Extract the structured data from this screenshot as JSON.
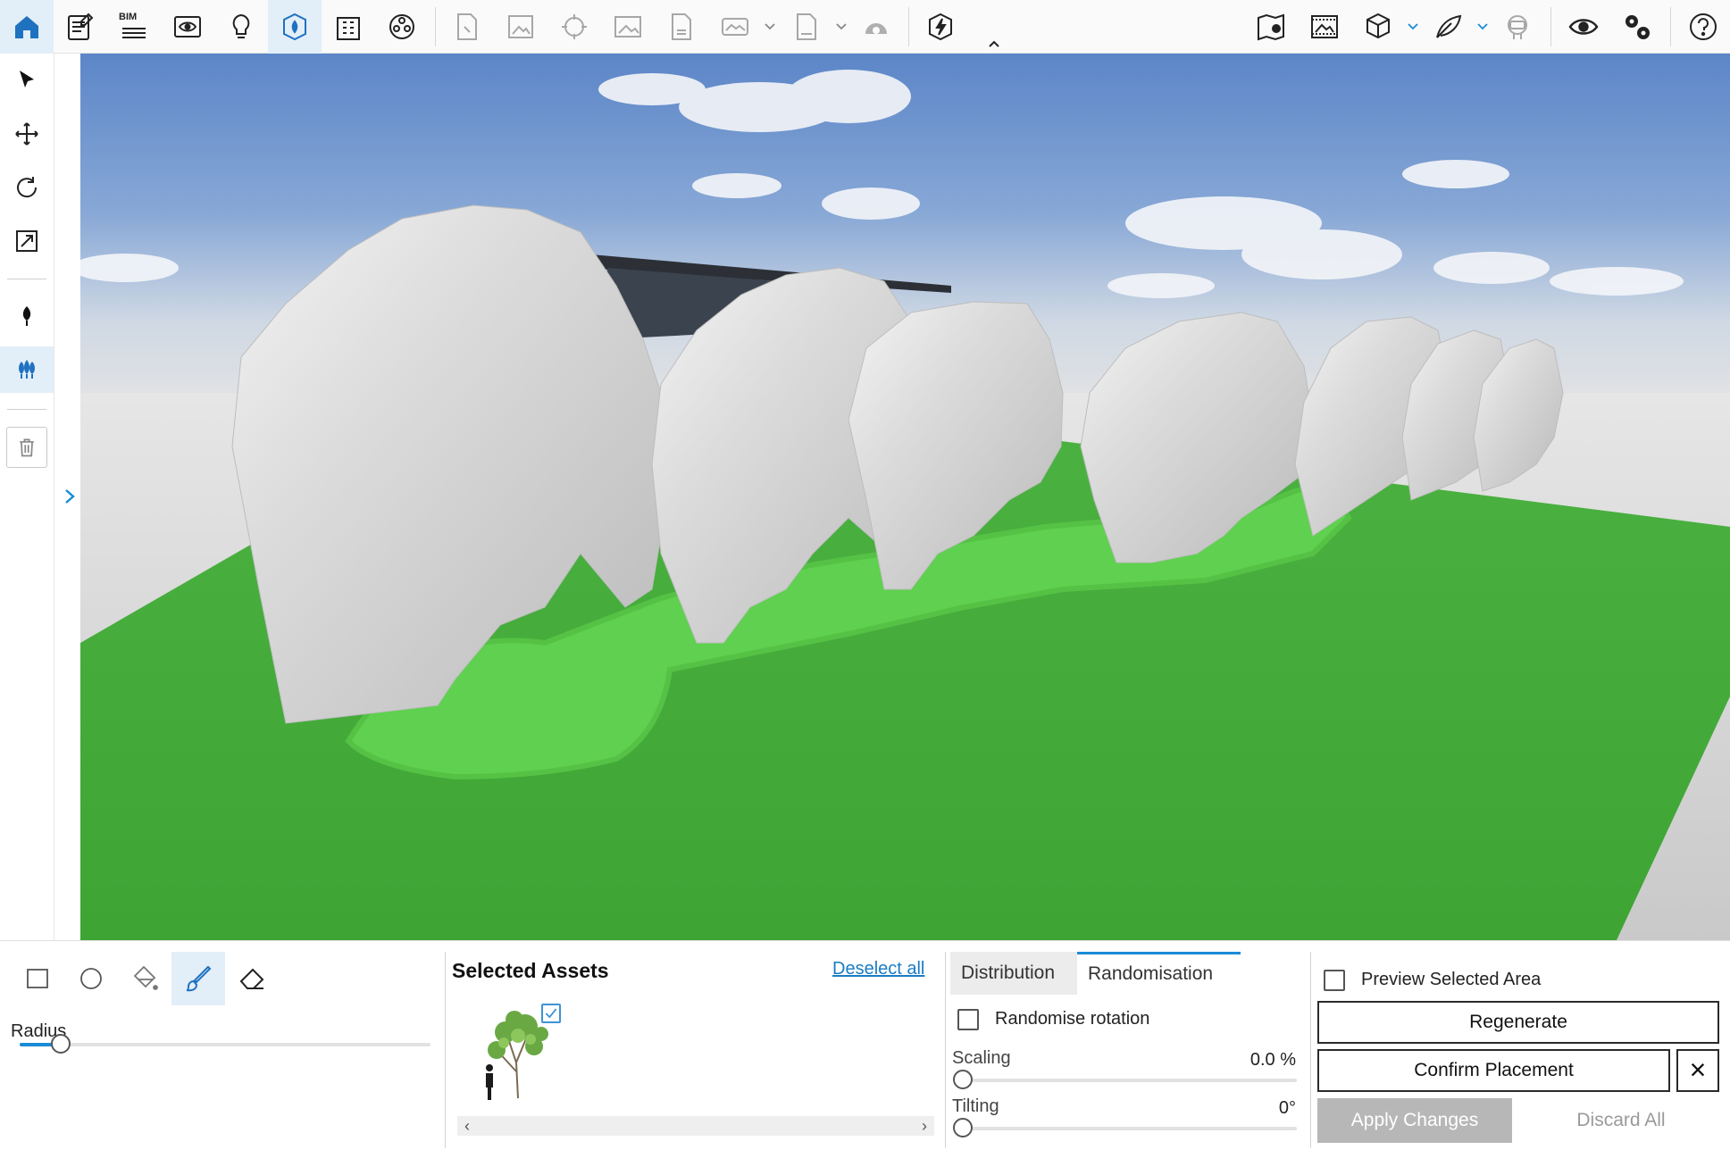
{
  "toolbar": {
    "bim_label": "BIM",
    "icons": [
      "home-icon",
      "project-info-icon",
      "bim-icon",
      "preview-icon",
      "lighting-icon",
      "vegetation-scatter-icon",
      "building-icon",
      "material-icon",
      "export-icon",
      "image-render-icon",
      "panorama-icon",
      "picture-icon",
      "document-export-icon",
      "360-render-icon",
      "exe-export-icon",
      "cloud-share-icon",
      "lightning-icon",
      "collapse-caret-icon",
      "map-location-icon",
      "texture-image-icon",
      "cube-view-icon",
      "feather-icon",
      "vr-headset-icon",
      "visibility-icon",
      "settings-icon",
      "help-icon"
    ]
  },
  "sidebar": {
    "tools": [
      "select-tool",
      "move-tool",
      "rotate-tool",
      "scale-tool",
      "single-tree-tool",
      "scatter-vegetation-tool",
      "delete-tool"
    ]
  },
  "colors": {
    "accent": "#1a8bd6",
    "active_bg": "#e2eef8",
    "grass": "#43a83a",
    "selection": "#5fd04f"
  },
  "panel": {
    "shape_tools": [
      "rectangle-select",
      "circle-select",
      "paint-bucket",
      "brush",
      "eraser"
    ],
    "radius": {
      "label": "Radius",
      "value_fraction": 0.1
    },
    "assets": {
      "title": "Selected Assets",
      "deselect_label": "Deselect all",
      "scroll_left": "‹",
      "scroll_right": "›"
    },
    "tabs": {
      "distribution": "Distribution",
      "randomisation": "Randomisation",
      "active": "randomisation"
    },
    "randomise_rotation_label": "Randomise rotation",
    "randomise_rotation_checked": false,
    "scaling": {
      "label": "Scaling",
      "value": "0.0 %"
    },
    "tilting": {
      "label": "Tilting",
      "value": "0°"
    },
    "actions": {
      "preview_label": "Preview Selected Area",
      "preview_checked": false,
      "regenerate": "Regenerate",
      "confirm": "Confirm Placement",
      "close_icon": "×",
      "apply": "Apply Changes",
      "discard": "Discard All"
    }
  }
}
